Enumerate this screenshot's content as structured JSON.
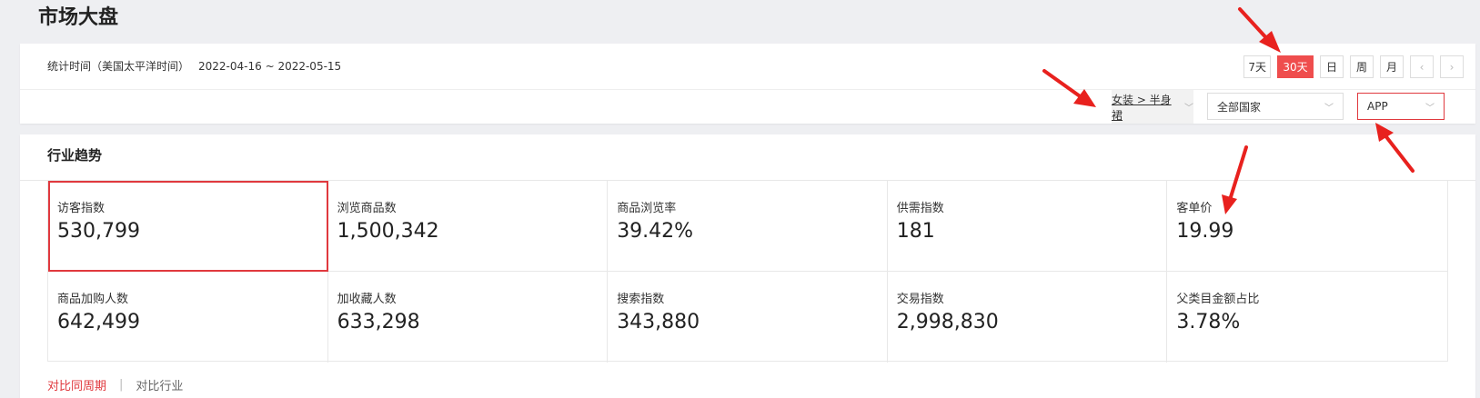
{
  "page": {
    "title": "市场大盘"
  },
  "filters": {
    "stat_label": "统计时间（美国太平洋时间）",
    "date_range": "2022-04-16 ~ 2022-05-15",
    "range_buttons": [
      "7天",
      "30天",
      "日",
      "周",
      "月"
    ],
    "active_range": "30天",
    "category": "女装 > 半身裙",
    "country": "全部国家",
    "platform": "APP"
  },
  "section": {
    "title": "行业趋势",
    "metrics": [
      {
        "label": "访客指数",
        "value": "530,799"
      },
      {
        "label": "浏览商品数",
        "value": "1,500,342"
      },
      {
        "label": "商品浏览率",
        "value": "39.42%"
      },
      {
        "label": "供需指数",
        "value": "181"
      },
      {
        "label": "客单价",
        "value": "19.99"
      },
      {
        "label": "商品加购人数",
        "value": "642,499"
      },
      {
        "label": "加收藏人数",
        "value": "633,298"
      },
      {
        "label": "搜索指数",
        "value": "343,880"
      },
      {
        "label": "交易指数",
        "value": "2,998,830"
      },
      {
        "label": "父类目金额占比",
        "value": "3.78%"
      }
    ]
  },
  "compare": {
    "period": "对比同周期",
    "industry": "对比行业"
  },
  "colors": {
    "accent": "#e0393e",
    "active_button": "#ef4d4d",
    "annotation_arrow": "#e8211e"
  }
}
